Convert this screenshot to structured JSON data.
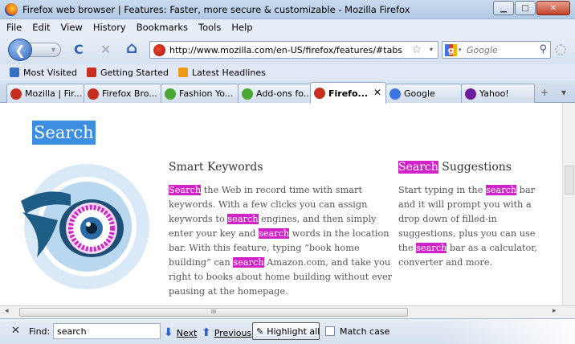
{
  "window": {
    "title": "Firefox web browser | Features: Faster, more secure & customizable - Mozilla Firefox",
    "minimize": "▁",
    "maximize": "□",
    "close": "✕"
  },
  "menu": [
    "File",
    "Edit",
    "View",
    "History",
    "Bookmarks",
    "Tools",
    "Help"
  ],
  "nav": {
    "back": "❮",
    "reload": "C",
    "stop": "✕",
    "home": "⌂",
    "url": "http://www.mozilla.com/en-US/firefox/features/#tabs",
    "star": "☆",
    "dropdown": "▾",
    "search_placeholder": "Google",
    "search_glyph": "⚲"
  },
  "bookmarks": [
    {
      "label": "Most Visited",
      "color": "#3a6ec0"
    },
    {
      "label": "Getting Started",
      "color": "#c62e1f"
    },
    {
      "label": "Latest Headlines",
      "color": "#f09a1a"
    }
  ],
  "tabs": [
    {
      "label": "Mozilla | Fir...",
      "color": "#c62e1f",
      "active": false
    },
    {
      "label": "Firefox Bro...",
      "color": "#c62e1f",
      "active": false
    },
    {
      "label": "Fashion Yo...",
      "color": "#4aa832",
      "active": false
    },
    {
      "label": "Add-ons fo...",
      "color": "#4aa832",
      "active": false
    },
    {
      "label": "Firefo...",
      "color": "#c62e1f",
      "active": true
    },
    {
      "label": "Google",
      "color": "#3a74e0",
      "active": false
    },
    {
      "label": "Yahoo!",
      "color": "#6a1d9a",
      "active": false
    }
  ],
  "tab_controls": {
    "new_tab": "+",
    "list": "▾"
  },
  "page": {
    "heading": "Search",
    "col1": {
      "title": "Smart Keywords",
      "lines": [
        [
          {
            "t": "Search",
            "h": true
          },
          {
            "t": " the Web in record time with smart",
            "h": false
          }
        ],
        [
          {
            "t": "keywords. With a few clicks you can assign",
            "h": false
          }
        ],
        [
          {
            "t": "keywords to ",
            "h": false
          },
          {
            "t": "search",
            "h": true
          },
          {
            "t": " engines, and then simply",
            "h": false
          }
        ],
        [
          {
            "t": "enter your key and ",
            "h": false
          },
          {
            "t": "search",
            "h": true
          },
          {
            "t": " words in the location",
            "h": false
          }
        ],
        [
          {
            "t": "bar. With this feature, typing “book home",
            "h": false
          }
        ],
        [
          {
            "t": "building” can ",
            "h": false
          },
          {
            "t": "search",
            "h": true
          },
          {
            "t": " Amazon.com, and take you",
            "h": false
          }
        ],
        [
          {
            "t": "right to books about home building without ever",
            "h": false
          }
        ],
        [
          {
            "t": "pausing at the homepage.",
            "h": false
          }
        ]
      ]
    },
    "col2": {
      "title_highlight": "Search",
      "title_rest": " Suggestions",
      "lines": [
        [
          {
            "t": "Start typing in the ",
            "h": false
          },
          {
            "t": "search",
            "h": true
          },
          {
            "t": " bar",
            "h": false
          }
        ],
        [
          {
            "t": "and it will prompt you with a",
            "h": false
          }
        ],
        [
          {
            "t": "drop down of filled-in",
            "h": false
          }
        ],
        [
          {
            "t": "suggestions, plus you can use",
            "h": false
          }
        ],
        [
          {
            "t": "the ",
            "h": false
          },
          {
            "t": "search",
            "h": true
          },
          {
            "t": " bar as a calculator,",
            "h": false
          }
        ],
        [
          {
            "t": "converter and more.",
            "h": false
          }
        ]
      ]
    }
  },
  "scroll": {
    "left": "◂",
    "right": "▸",
    "grip": "III"
  },
  "find": {
    "close": "✕",
    "label": "Find:",
    "value": "search",
    "next": "Next",
    "previous": "Previous",
    "highlight_all": "Highlight all",
    "match_case": "Match case",
    "next_arrow": "⬇",
    "prev_arrow": "⬆"
  }
}
